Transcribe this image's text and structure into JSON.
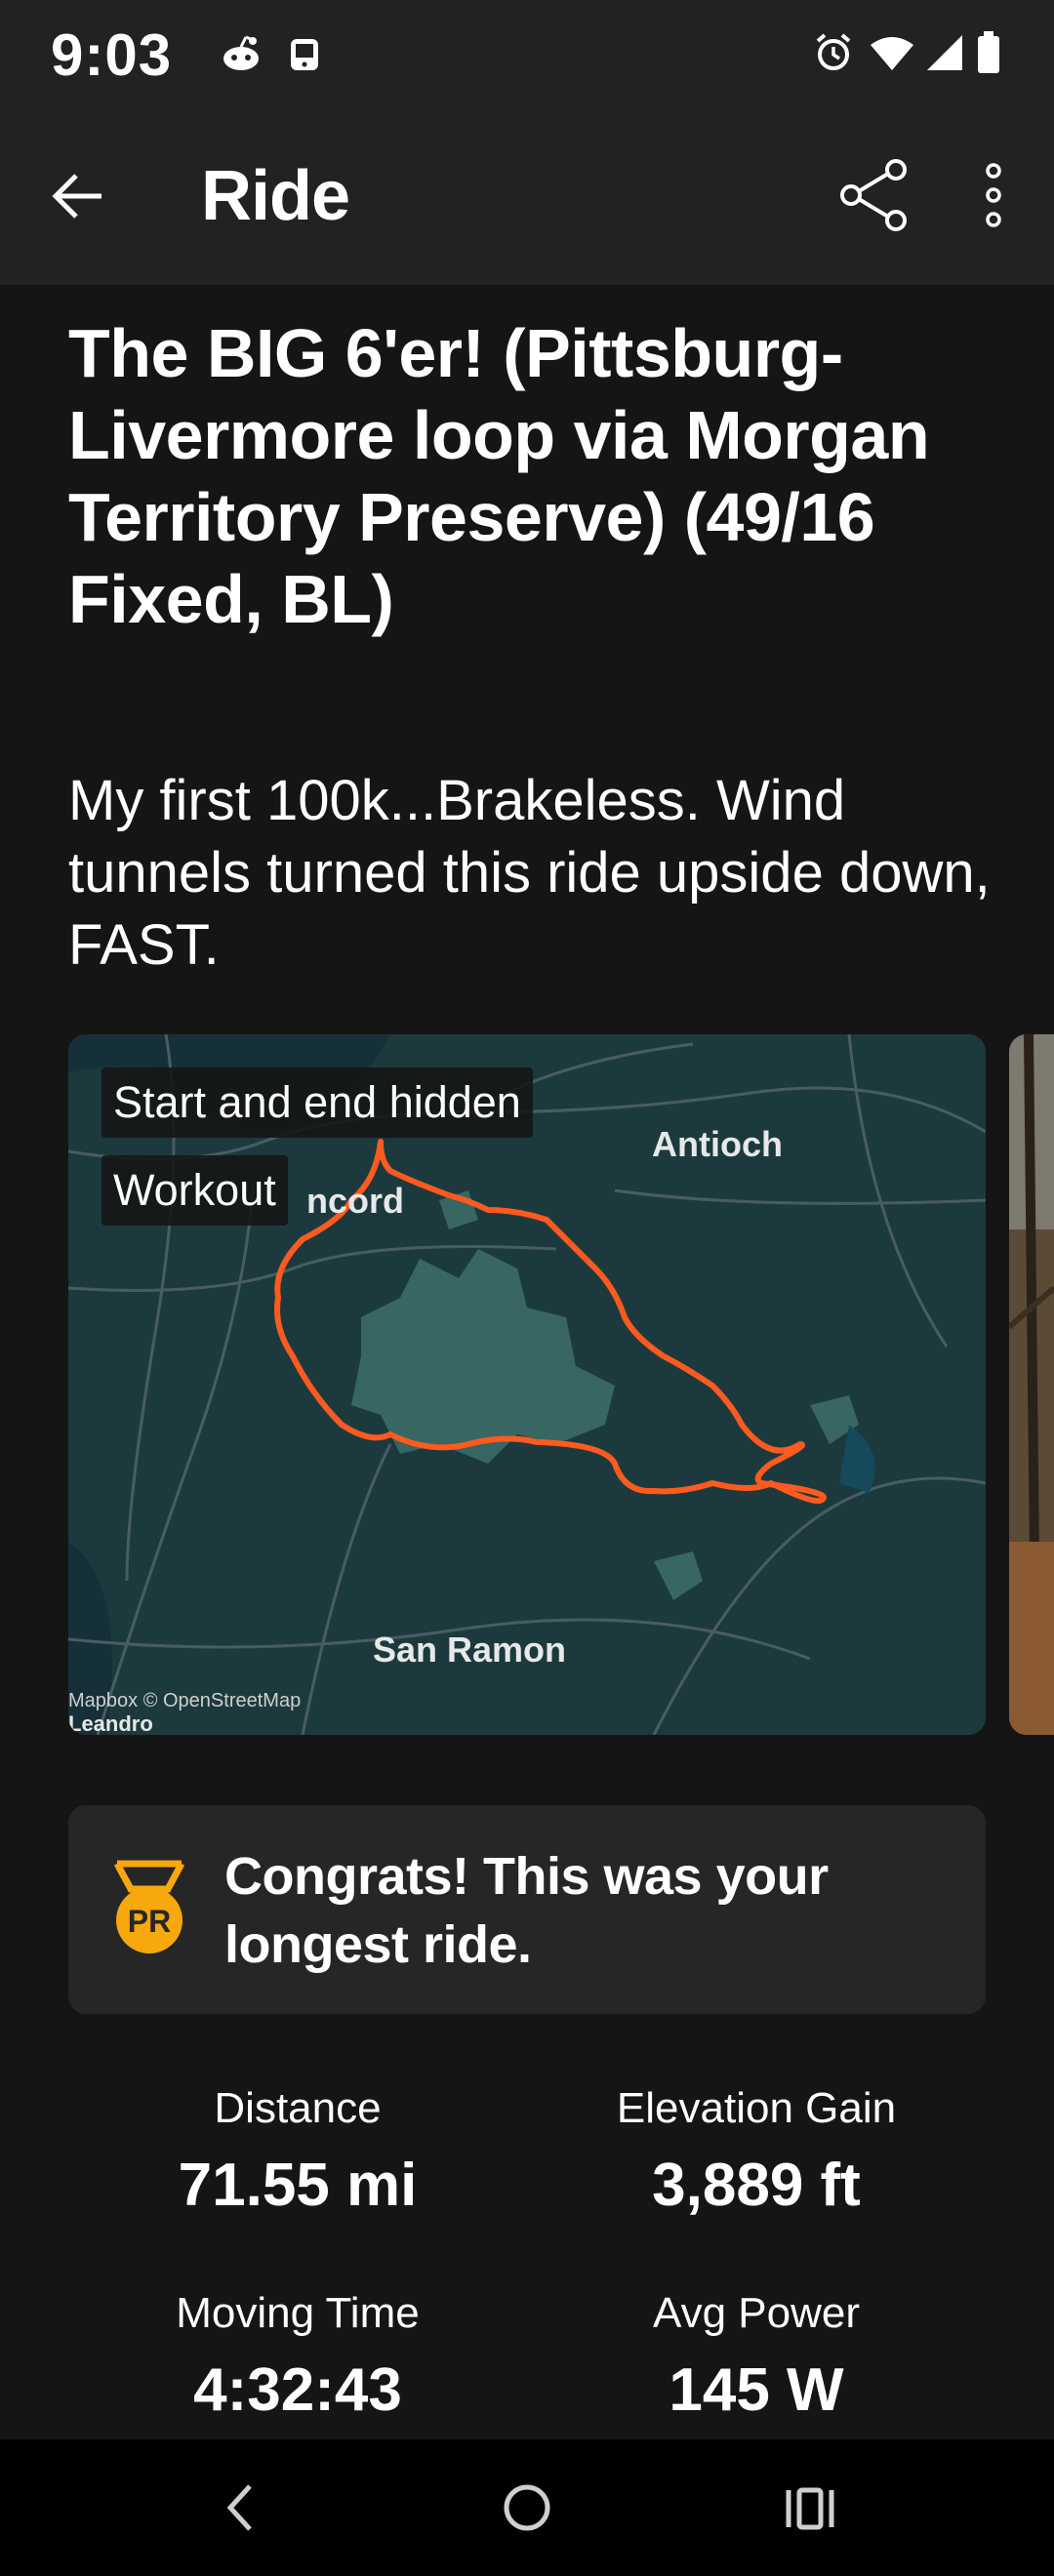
{
  "status_bar": {
    "time": "9:03",
    "left_icons": [
      "reddit-icon",
      "tablet-icon"
    ],
    "right_icons": [
      "alarm-icon",
      "wifi-icon",
      "cell-signal-icon",
      "battery-icon"
    ]
  },
  "app_bar": {
    "title": "Ride",
    "back_icon": "arrow-left-icon",
    "share_icon": "share-icon",
    "more_icon": "more-vertical-icon"
  },
  "activity": {
    "title": "The BIG 6'er! (Pittsburg-Livermore loop via Morgan Territory Preserve) (49/16 Fixed, BL)",
    "description": "My first 100k...Brakeless. Wind tunnels turned this ride upside down, FAST."
  },
  "map": {
    "tag_privacy": "Start and end hidden",
    "tag_type": "Workout",
    "places": [
      "Antioch",
      "ncord",
      "San Ramon",
      "Leandro"
    ],
    "attribution": "Mapbox © OpenStreetMap",
    "route_color": "#ff5a1f",
    "land_color": "#1c3a3e",
    "park_color": "#3d6e68"
  },
  "achievement": {
    "icon": "pr-medal-icon",
    "badge_text": "PR",
    "text": "Congrats! This was your longest ride.",
    "accent_color": "#f7a80d"
  },
  "stats": [
    {
      "label": "Distance",
      "value": "71.55 mi"
    },
    {
      "label": "Elevation Gain",
      "value": "3,889 ft"
    },
    {
      "label": "Moving Time",
      "value": "4:32:43"
    },
    {
      "label": "Avg Power",
      "value": "145 W"
    }
  ],
  "nav_bar": {
    "icons": [
      "back-triangle-icon",
      "home-circle-icon",
      "recents-icon"
    ]
  }
}
